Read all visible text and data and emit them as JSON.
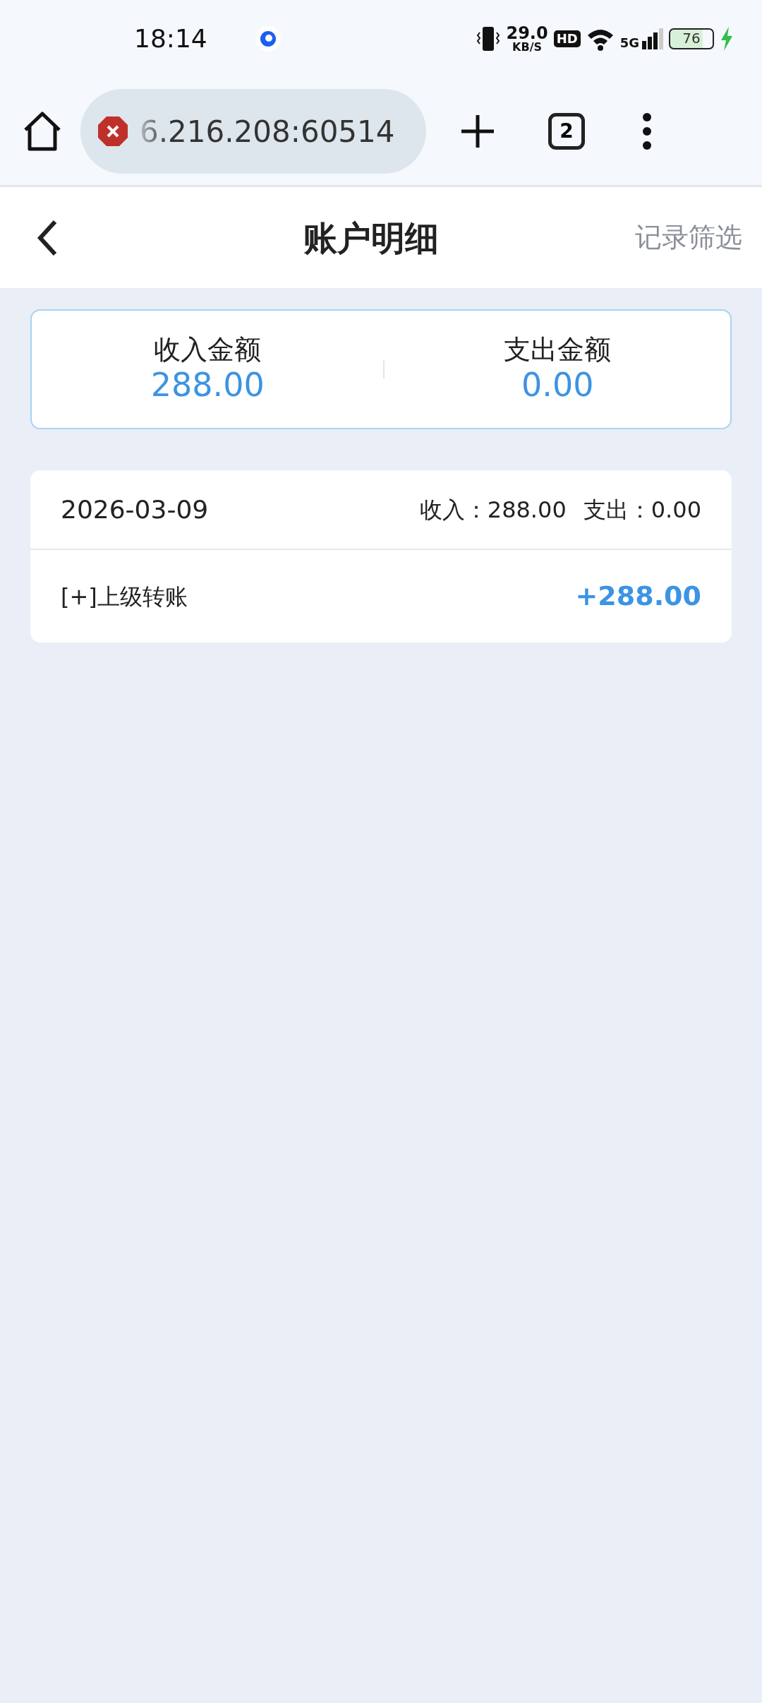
{
  "status_bar": {
    "time": "18:14",
    "net_speed": "29.0",
    "net_unit": "KB/S",
    "hd_badge": "HD",
    "network": "5G",
    "battery": "76",
    "charging": true
  },
  "browser": {
    "url": "6.216.208:60514",
    "secure": false,
    "tab_count": "2"
  },
  "header": {
    "title": "账户明细",
    "action": "记录筛选"
  },
  "summary": [
    {
      "label": "收入金额",
      "value": "288.00"
    },
    {
      "label": "支出金额",
      "value": "0.00"
    }
  ],
  "days": [
    {
      "date": "2026-03-09",
      "income": "收入：288.00",
      "expense": "支出：0.00",
      "records": [
        {
          "title": "[+]上级转账",
          "amount": "+288.00"
        }
      ]
    }
  ]
}
